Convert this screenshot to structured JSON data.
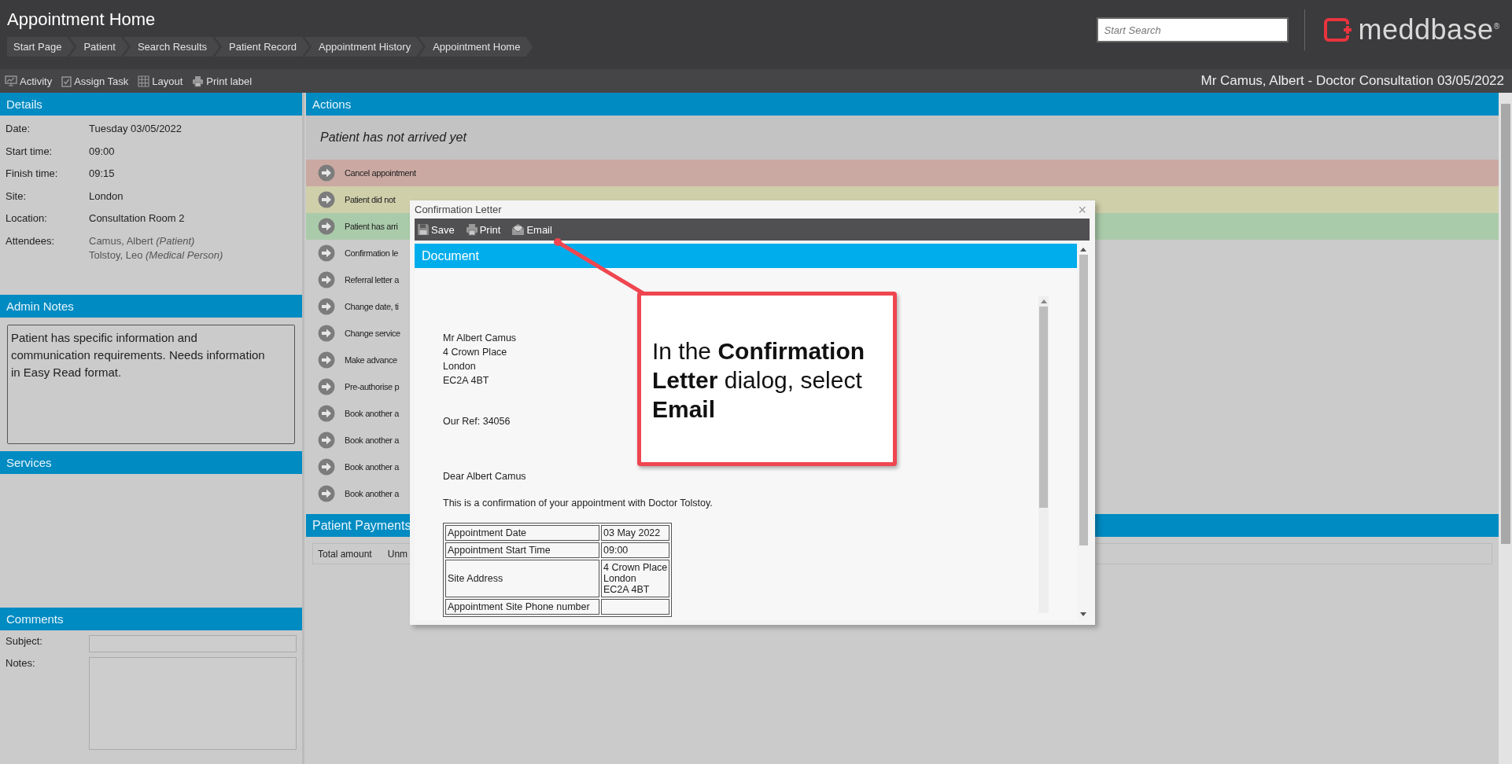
{
  "page": {
    "title": "Appointment Home",
    "search": {
      "placeholder": "Start Search"
    },
    "logo": {
      "text": "meddbase",
      "mark": "®"
    }
  },
  "breadcrumbs": [
    "Start Page",
    "Patient",
    "Search Results",
    "Patient Record",
    "Appointment History",
    "Appointment Home"
  ],
  "toolbar": [
    "Activity",
    "Assign Task",
    "Layout",
    "Print label"
  ],
  "appointment_title": "Mr Camus, Albert - Doctor Consultation 03/05/2022",
  "details": {
    "title": "Details",
    "fields": [
      {
        "label": "Date:",
        "values": [
          "Tuesday 03/05/2022"
        ]
      },
      {
        "label": "Start time:",
        "values": [
          "09:00"
        ]
      },
      {
        "label": "Finish time:",
        "values": [
          "09:15"
        ]
      },
      {
        "label": "Site:",
        "values": [
          "London"
        ]
      },
      {
        "label": "Location:",
        "values": [
          "Consultation Room 2"
        ]
      },
      {
        "label": "Attendees:",
        "kind": "attendees",
        "values": [
          "Camus, Albert *(Patient)*",
          "Tolstoy, Leo *(Medical Person)*"
        ]
      }
    ]
  },
  "admin_notes": {
    "title": "Admin Notes",
    "text": "Patient has specific information and communication requirements. Needs information in Easy Read format."
  },
  "services": {
    "title": "Services"
  },
  "comments": {
    "title": "Comments",
    "fields": [
      {
        "label": "Subject:",
        "kind": "line"
      },
      {
        "label": "Notes:",
        "kind": "area"
      }
    ]
  },
  "actions": {
    "title": "Actions",
    "status": "Patient has not arrived yet",
    "items": [
      {
        "label": "Cancel appointment",
        "color": "#cba9a3"
      },
      {
        "label": "Patient did not",
        "color": "#cfcfaa"
      },
      {
        "label": "Patient has arri",
        "color": "#aacbaa"
      },
      {
        "label": "Confirmation le",
        "color": "#cbcbcb"
      },
      {
        "label": "Referral letter a",
        "color": "#cbcbcb"
      },
      {
        "label": "Change date, ti",
        "color": "#cbcbcb"
      },
      {
        "label": "Change service",
        "color": "#cbcbcb"
      },
      {
        "label": "Make advance",
        "color": "#cbcbcb"
      },
      {
        "label": "Pre-authorise p",
        "color": "#cbcbcb"
      },
      {
        "label": "Book another a",
        "color": "#cbcbcb"
      },
      {
        "label": "Book another a",
        "color": "#cbcbcb"
      },
      {
        "label": "Book another a",
        "color": "#cbcbcb"
      },
      {
        "label": "Book another a",
        "color": "#cbcbcb"
      }
    ]
  },
  "payments": {
    "title": "Patient Payments",
    "columns": [
      "Total amount",
      "Unm"
    ]
  },
  "dialog": {
    "title": "Confirmation Letter",
    "close": "×",
    "toolbar": [
      "Save",
      "Print",
      "Email"
    ],
    "document_title": "Document",
    "letter": {
      "address": [
        "Mr Albert Camus",
        "4 Crown Place",
        "London",
        "EC2A 4BT"
      ],
      "reference": "Our Ref: 34056",
      "greeting": "Dear Albert Camus",
      "body": "This is a confirmation of your appointment with Doctor Tolstoy.",
      "table": [
        {
          "label": "Appointment Date",
          "values": [
            "03 May 2022"
          ]
        },
        {
          "label": "Appointment Start Time",
          "values": [
            "09:00"
          ]
        },
        {
          "label": "Site Address",
          "values": [
            "4 Crown Place",
            "London",
            "EC2A 4BT"
          ]
        },
        {
          "label": "Appointment Site Phone number"
        }
      ]
    }
  },
  "callout": {
    "text": "In the **Confirmation Letter** dialog, select **Email**"
  }
}
